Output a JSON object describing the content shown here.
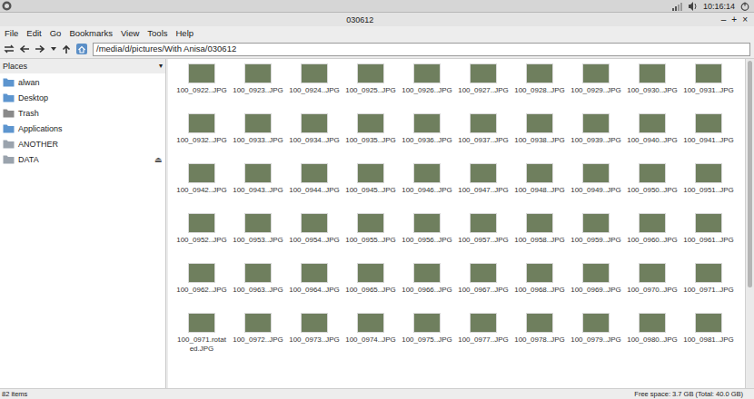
{
  "panel": {
    "time": "10:16:14"
  },
  "window": {
    "title": "030612",
    "controls": [
      "–",
      "+",
      "×"
    ]
  },
  "menu": [
    "File",
    "Edit",
    "Go",
    "Bookmarks",
    "View",
    "Tools",
    "Help"
  ],
  "toolbar": {
    "path": "/media/d/pictures/With Anisa/030612"
  },
  "sidebar": {
    "header": "Places",
    "toggle": "▾",
    "items": [
      {
        "label": "alwan",
        "selected": false
      },
      {
        "label": "Desktop",
        "selected": false
      },
      {
        "label": "Trash",
        "selected": false
      },
      {
        "label": "Applications",
        "selected": false
      },
      {
        "label": "ANOTHER",
        "selected": false
      },
      {
        "label": "DATA",
        "selected": false,
        "eject": "⏏"
      }
    ]
  },
  "files": [
    {
      "name": "100_0922..JPG",
      "selected": false
    },
    {
      "name": "100_0923..JPG",
      "selected": false
    },
    {
      "name": "100_0924..JPG",
      "selected": false
    },
    {
      "name": "100_0925..JPG",
      "selected": false
    },
    {
      "name": "100_0926..JPG",
      "selected": false
    },
    {
      "name": "100_0927..JPG",
      "selected": false
    },
    {
      "name": "100_0928..JPG",
      "selected": false
    },
    {
      "name": "100_0929..JPG",
      "selected": false
    },
    {
      "name": "100_0930..JPG",
      "selected": false
    },
    {
      "name": "100_0931..JPG",
      "selected": false
    },
    {
      "name": "100_0932..JPG",
      "selected": false
    },
    {
      "name": "100_0933..JPG",
      "selected": false
    },
    {
      "name": "100_0934..JPG",
      "selected": false
    },
    {
      "name": "100_0935..JPG",
      "selected": false
    },
    {
      "name": "100_0936..JPG",
      "selected": false
    },
    {
      "name": "100_0937..JPG",
      "selected": false
    },
    {
      "name": "100_0938..JPG",
      "selected": false
    },
    {
      "name": "100_0939..JPG",
      "selected": false
    },
    {
      "name": "100_0940..JPG",
      "selected": false
    },
    {
      "name": "100_0941..JPG",
      "selected": false
    },
    {
      "name": "100_0942..JPG",
      "selected": false
    },
    {
      "name": "100_0943..JPG",
      "selected": false
    },
    {
      "name": "100_0944..JPG",
      "selected": false
    },
    {
      "name": "100_0945..JPG",
      "selected": false
    },
    {
      "name": "100_0946..JPG",
      "selected": false
    },
    {
      "name": "100_0947..JPG",
      "selected": false
    },
    {
      "name": "100_0948..JPG",
      "selected": false
    },
    {
      "name": "100_0949..JPG",
      "selected": false
    },
    {
      "name": "100_0950..JPG",
      "selected": false
    },
    {
      "name": "100_0951..JPG",
      "selected": false
    },
    {
      "name": "100_0952..JPG",
      "selected": false
    },
    {
      "name": "100_0953..JPG",
      "selected": false
    },
    {
      "name": "100_0954..JPG",
      "selected": false
    },
    {
      "name": "100_0955..JPG",
      "selected": false
    },
    {
      "name": "100_0956..JPG",
      "selected": false
    },
    {
      "name": "100_0957..JPG",
      "selected": false
    },
    {
      "name": "100_0958..JPG",
      "selected": false
    },
    {
      "name": "100_0959..JPG",
      "selected": false
    },
    {
      "name": "100_0960..JPG",
      "selected": false
    },
    {
      "name": "100_0961..JPG",
      "selected": false
    },
    {
      "name": "100_0962..JPG",
      "selected": false
    },
    {
      "name": "100_0963..JPG",
      "selected": false
    },
    {
      "name": "100_0964..JPG",
      "selected": false
    },
    {
      "name": "100_0965..JPG",
      "selected": false
    },
    {
      "name": "100_0966..JPG",
      "selected": false
    },
    {
      "name": "100_0967..JPG",
      "selected": false
    },
    {
      "name": "100_0968..JPG",
      "selected": false
    },
    {
      "name": "100_0969..JPG",
      "selected": false
    },
    {
      "name": "100_0970..JPG",
      "selected": false
    },
    {
      "name": "100_0971..JPG",
      "selected": false
    },
    {
      "name": "100_0971.rotated.JPG",
      "selected": false
    },
    {
      "name": "100_0972..JPG",
      "selected": false
    },
    {
      "name": "100_0973..JPG",
      "selected": false
    },
    {
      "name": "100_0974..JPG",
      "selected": false
    },
    {
      "name": "100_0975..JPG",
      "selected": false
    },
    {
      "name": "100_0977..JPG",
      "selected": false
    },
    {
      "name": "100_0978..JPG",
      "selected": false
    },
    {
      "name": "100_0979..JPG",
      "selected": false
    },
    {
      "name": "100_0980..JPG",
      "selected": false
    },
    {
      "name": "100_0981..JPG",
      "selected": false
    }
  ],
  "status_bar": {
    "count": "82 items",
    "free_space": "Free space: 3.7 GB (Total: 40.0 GB)"
  }
}
